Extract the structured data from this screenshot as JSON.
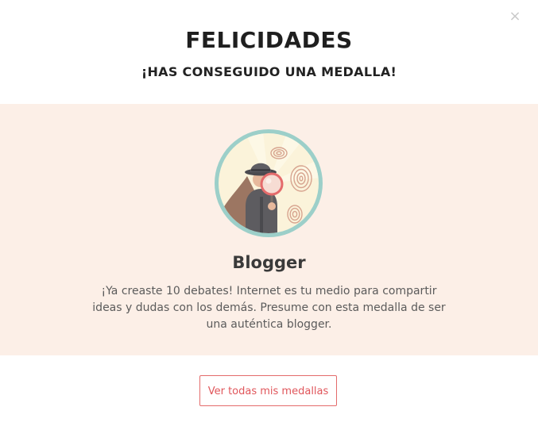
{
  "modal": {
    "close_glyph": "×",
    "title": "FELICIDADES",
    "subtitle": "¡HAS CONSEGUIDO UNA MEDALLA!"
  },
  "badge": {
    "icon": "detective-magnifier-fingerprints-icon",
    "name": "Blogger",
    "description": "¡Ya creaste 10 debates! Internet es tu medio para compartir ideas y dudas con los demás. Presume con esta medalla de ser una auténtica blogger."
  },
  "actions": {
    "view_all_label": "Ver todas mis medallas"
  },
  "colors": {
    "band_background": "#fcefe7",
    "accent": "#e0565b",
    "medal_ring": "#9ccfc9",
    "medal_fill": "#fbf3da"
  }
}
